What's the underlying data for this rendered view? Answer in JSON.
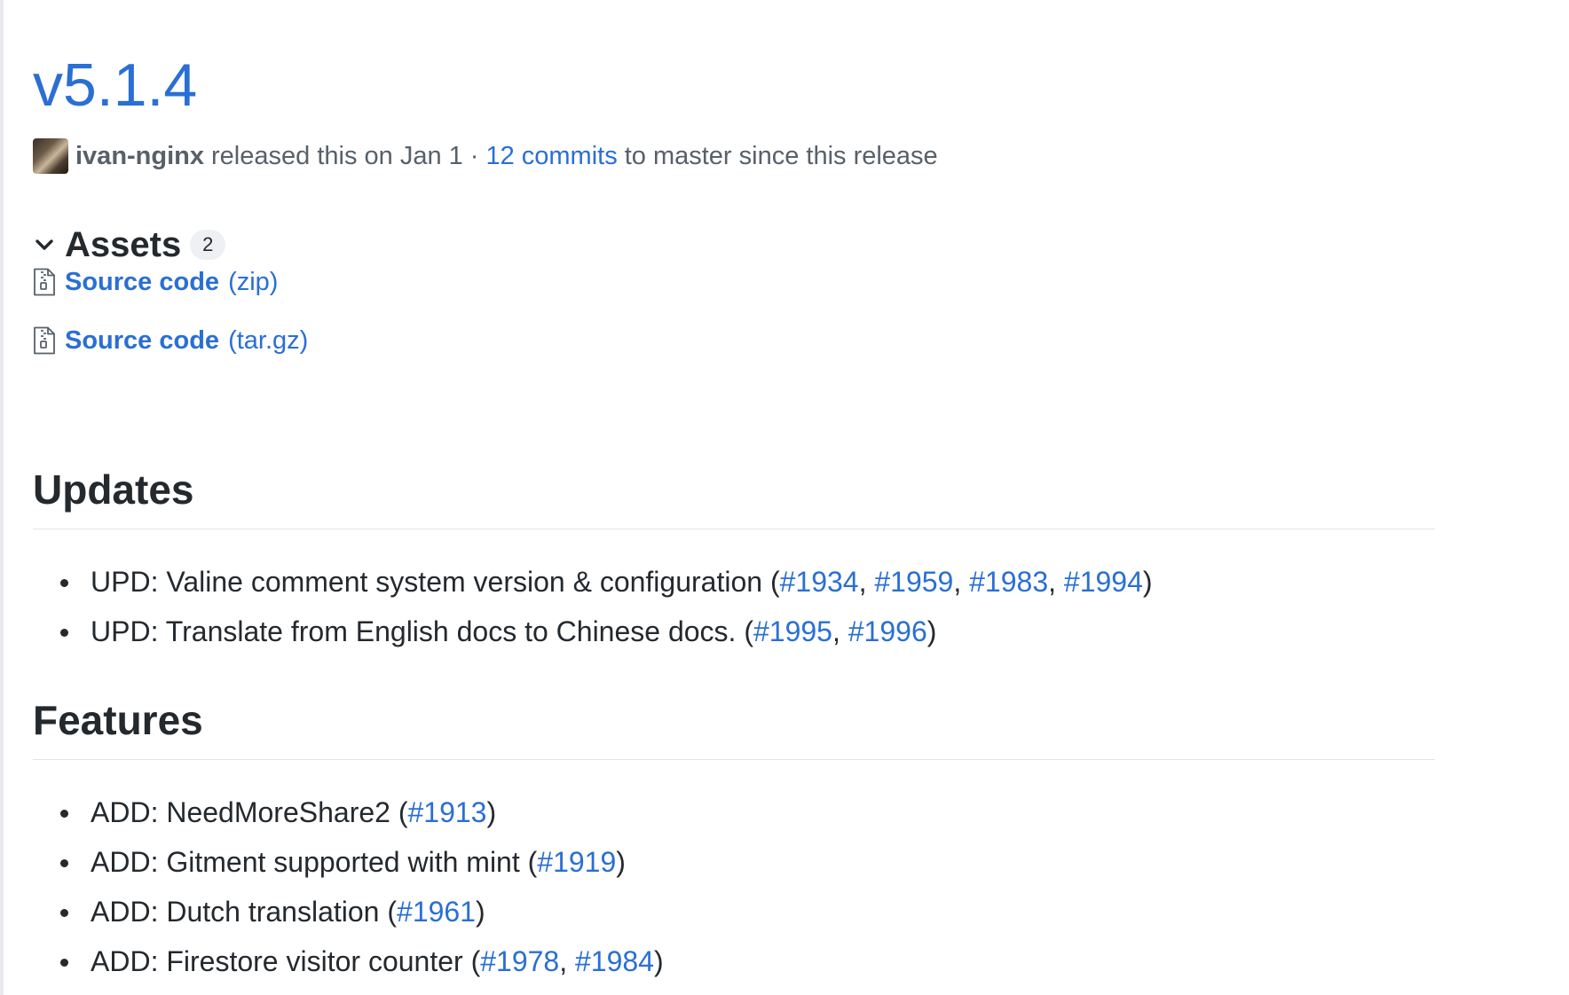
{
  "release": {
    "title": "v5.1.4",
    "author": "ivan-nginx",
    "released_text": "released this on Jan 1",
    "separator": "·",
    "commits_link": "12 commits",
    "commits_suffix": "to master since this release"
  },
  "assets": {
    "title": "Assets",
    "count": "2",
    "items": [
      {
        "name": "Source code",
        "ext": "(zip)"
      },
      {
        "name": "Source code",
        "ext": "(tar.gz)"
      }
    ]
  },
  "updates": {
    "heading": "Updates",
    "items": [
      {
        "text": "UPD: Valine comment system version & configuration (",
        "links": [
          "#1934",
          "#1959",
          "#1983",
          "#1994"
        ],
        "close": ")"
      },
      {
        "text": "UPD: Translate from English docs to Chinese docs. (",
        "links": [
          "#1995",
          "#1996"
        ],
        "close": ")"
      }
    ]
  },
  "features": {
    "heading": "Features",
    "items": [
      {
        "text": "ADD: NeedMoreShare2 (",
        "links": [
          "#1913"
        ],
        "close": ")"
      },
      {
        "text": "ADD: Gitment supported with mint (",
        "links": [
          "#1919"
        ],
        "close": ")"
      },
      {
        "text": "ADD: Dutch translation (",
        "links": [
          "#1961"
        ],
        "close": ")"
      },
      {
        "text": "ADD: Firestore visitor counter (",
        "links": [
          "#1978",
          "#1984"
        ],
        "close": ")"
      }
    ]
  },
  "colors": {
    "link": "#2a6fd4",
    "text": "#24292e",
    "muted": "#586069",
    "divider": "#e1e4e8"
  },
  "icons": {
    "chevron": "chevron-down-icon",
    "file": "file-zip-icon"
  }
}
